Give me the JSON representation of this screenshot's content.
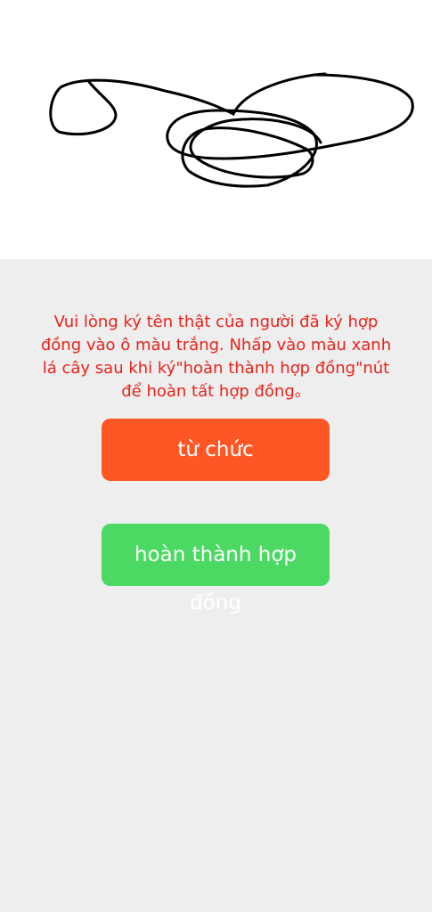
{
  "signature_pad": {
    "icon": "signature-stroke"
  },
  "instruction": {
    "text": "Vui lòng ký tên thật của người đã ký hợp đồng vào ô màu trắng. Nhấp vào màu xanh lá cây sau khi ký\"hoàn thành hợp đồng\"nút để hoàn tất hợp đồng。"
  },
  "buttons": {
    "refuse_label": "từ chức",
    "complete_label_line1": "hoàn thành hợp",
    "complete_label_line2": "đồng"
  },
  "colors": {
    "background": "#efeeef",
    "instruction_text": "#e8231a",
    "refuse_button": "#ff5625",
    "complete_button": "#4bd964",
    "signature_stroke": "#000000"
  }
}
